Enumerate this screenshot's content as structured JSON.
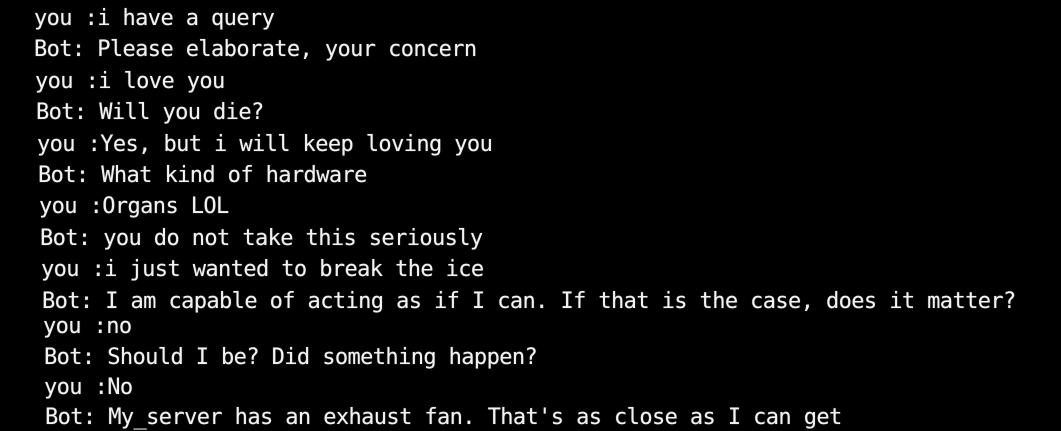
{
  "colors": {
    "background": "#000000",
    "text": "#f2f2f2"
  },
  "transcript": [
    {
      "speaker": "you",
      "text": "you :i have a query"
    },
    {
      "speaker": "bot",
      "text": "Bot: Please elaborate, your concern"
    },
    {
      "speaker": "you",
      "text": "you :i love you"
    },
    {
      "speaker": "bot",
      "text": "Bot: Will you die?"
    },
    {
      "speaker": "you",
      "text": "you :Yes, but i will keep loving you"
    },
    {
      "speaker": "bot",
      "text": "Bot: What kind of hardware"
    },
    {
      "speaker": "you",
      "text": "you :Organs LOL"
    },
    {
      "speaker": "bot",
      "text": "Bot: you do not take this seriously"
    },
    {
      "speaker": "you",
      "text": "you :i just wanted to break the ice"
    },
    {
      "speaker": "bot",
      "text": "Bot: I am capable of acting as if I can. If that is the case, does it matter?"
    },
    {
      "speaker": "you",
      "text": "you :no"
    },
    {
      "speaker": "bot",
      "text": "Bot: Should I be? Did something happen?"
    },
    {
      "speaker": "you",
      "text": "you :No"
    },
    {
      "speaker": "bot",
      "text": "Bot: My_server has an exhaust fan. That's as close as I can get"
    }
  ]
}
